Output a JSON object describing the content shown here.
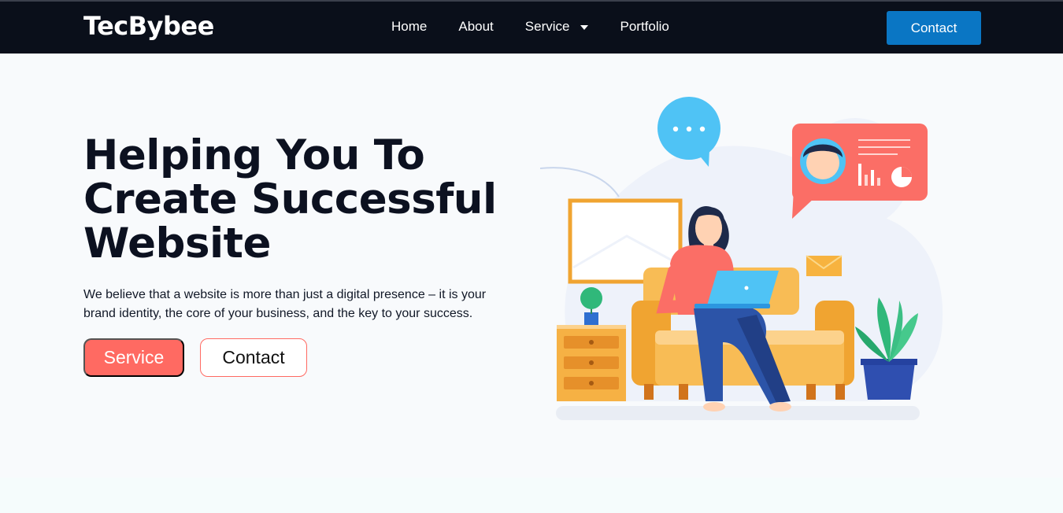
{
  "brand": {
    "logo": "TecBybee"
  },
  "nav": {
    "items": [
      "Home",
      "About",
      "Service",
      "Portfolio"
    ],
    "contact_label": "Contact"
  },
  "hero": {
    "title_lines": [
      "Helping You To",
      "Create Successful",
      "Website"
    ],
    "description_lines": [
      "We believe that a website is more than just a digital presence – it is your",
      "brand identity, the core of your business, and the key to your success."
    ],
    "primary_button": "Service",
    "secondary_button": "Contact"
  },
  "colors": {
    "navbar": "#0a0f1a",
    "accent_blue": "#0a76c4",
    "accent_coral": "#ff6a62",
    "page_bg": "#f8fafc"
  }
}
